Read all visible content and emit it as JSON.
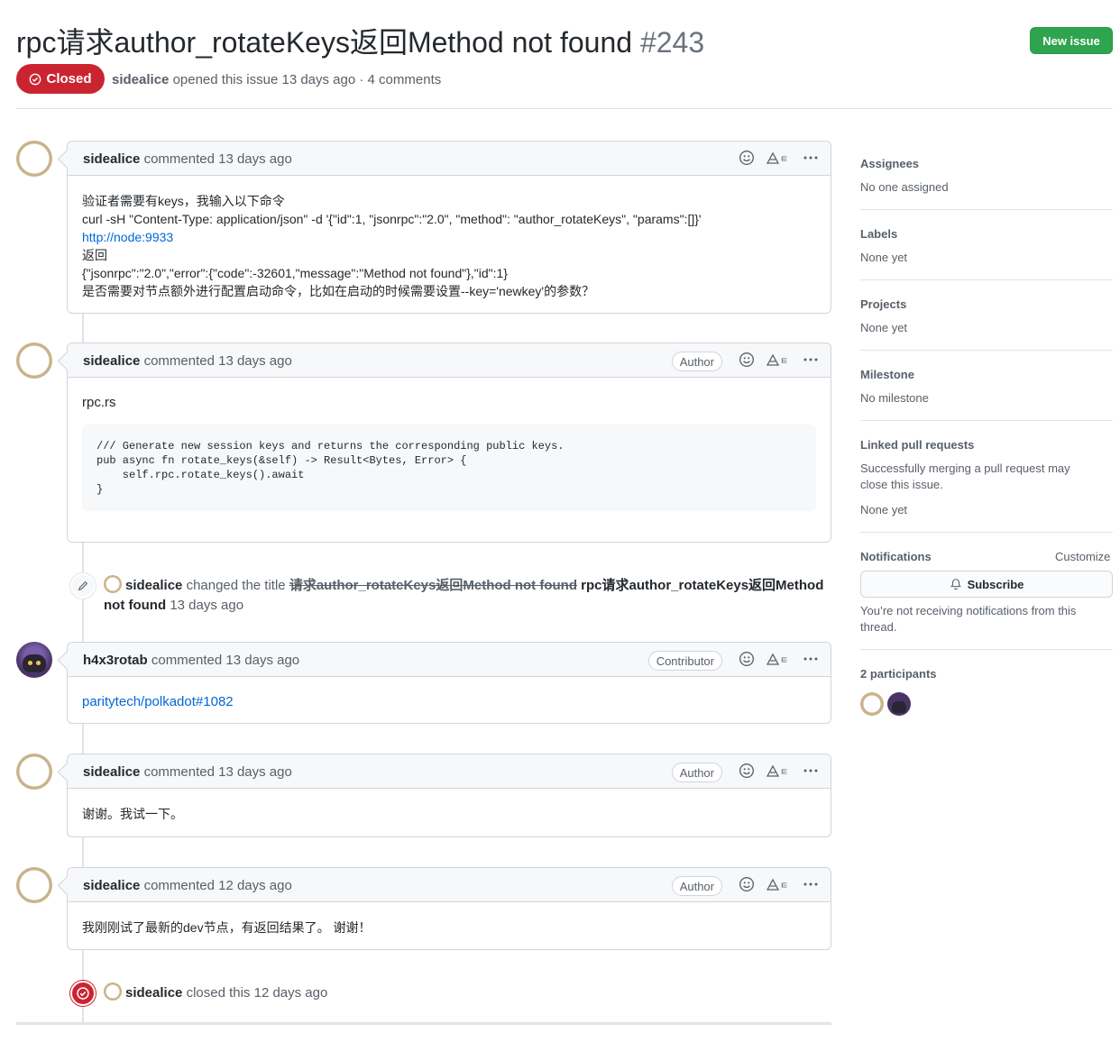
{
  "header": {
    "title": "rpc请求author_rotateKeys返回Method not found",
    "number": "#243",
    "new_issue_label": "New issue",
    "state": "Closed",
    "author": "sidealice",
    "meta_text": "opened this issue 13 days ago · 4 comments"
  },
  "comments": [
    {
      "author": "sidealice",
      "meta": "commented 13 days ago",
      "badge": "",
      "lines": [
        "验证者需要有keys，我输入以下命令",
        "curl -sH \"Content-Type: application/json\" -d '{\"id\":1, \"jsonrpc\":\"2.0\", \"method\": \"author_rotateKeys\", \"params\":[]}'",
        "返回",
        "{\"jsonrpc\":\"2.0\",\"error\":{\"code\":-32601,\"message\":\"Method not found\"},\"id\":1}",
        "是否需要对节点额外进行配置启动命令，比如在启动的时候需要设置--key='newkey'的参数？"
      ],
      "link": "http://node:9933"
    },
    {
      "author": "sidealice",
      "meta": "commented 13 days ago",
      "badge": "Author",
      "text": "rpc.rs",
      "code": "/// Generate new session keys and returns the corresponding public keys.\npub async fn rotate_keys(&self) -> Result<Bytes, Error> {\n    self.rpc.rotate_keys().await\n}"
    },
    {
      "author": "h4x3rotab",
      "meta": "commented 13 days ago",
      "badge": "Contributor",
      "link": "paritytech/polkadot#1082"
    },
    {
      "author": "sidealice",
      "meta": "commented 13 days ago",
      "badge": "Author",
      "text": "谢谢。我试一下。"
    },
    {
      "author": "sidealice",
      "meta": "commented 12 days ago",
      "badge": "Author",
      "text": "我刚刚试了最新的dev节点，有返回结果了。 谢谢！"
    }
  ],
  "events": {
    "rename": {
      "actor": "sidealice",
      "action": "changed the title",
      "old_title": "请求author_rotateKeys返回Method not found",
      "new_title_1": "rpc请求author_rotateKeys返回Method",
      "new_title_2": "not found",
      "time": "13 days ago"
    },
    "closed": {
      "actor": "sidealice",
      "text": "closed this 12 days ago"
    }
  },
  "sidebar": {
    "assignees_label": "Assignees",
    "assignees_value": "No one assigned",
    "labels_label": "Labels",
    "labels_value": "None yet",
    "projects_label": "Projects",
    "projects_value": "None yet",
    "milestone_label": "Milestone",
    "milestone_value": "No milestone",
    "linked_label": "Linked pull requests",
    "linked_desc_1": "Successfully merging a pull request may",
    "linked_desc_2": "close this issue.",
    "linked_value": "None yet",
    "notifications_label": "Notifications",
    "customize_label": "Customize",
    "subscribe_label": "Subscribe",
    "notif_desc_1": "You’re not receiving notifications from this",
    "notif_desc_2": "thread.",
    "participants_label": "2 participants"
  },
  "colors": {
    "closed_red": "#cb2431",
    "new_issue_green": "#2ea44f",
    "link_blue": "#0366d6"
  }
}
